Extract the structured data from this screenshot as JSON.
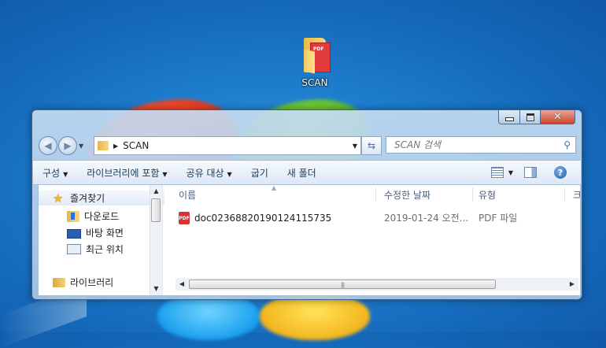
{
  "desktop": {
    "icon_label": "SCAN",
    "icon_badge": "PDF"
  },
  "window": {
    "caption_buttons": {
      "minimize_icon": "minimize-icon",
      "maximize_icon": "maximize-icon",
      "close_icon": "close-icon"
    },
    "address": {
      "path": "SCAN"
    },
    "search": {
      "placeholder": "SCAN 검색"
    },
    "toolbar": {
      "organize": "구성",
      "include_library": "라이브러리에 포함",
      "share_with": "공유 대상",
      "burn": "굽기",
      "new_folder": "새 폴더"
    },
    "nav_pane": {
      "favorites": "즐겨찾기",
      "downloads": "다운로드",
      "desktop": "바탕 화면",
      "recent": "최근 위치",
      "libraries": "라이브러리"
    },
    "columns": {
      "name": "이름",
      "date_modified": "수정한 날짜",
      "type": "유형",
      "size_partial": "크"
    },
    "files": [
      {
        "name": "doc02368820190124115735",
        "date": "2019-01-24 오전...",
        "type": "PDF 파일",
        "icon_label": "PDF"
      }
    ]
  },
  "colors": {
    "desktop_bg": "#1e7fcf",
    "window_frame": "#c4dbf1",
    "close_button": "#c9452e",
    "link_text": "#1e395b"
  }
}
